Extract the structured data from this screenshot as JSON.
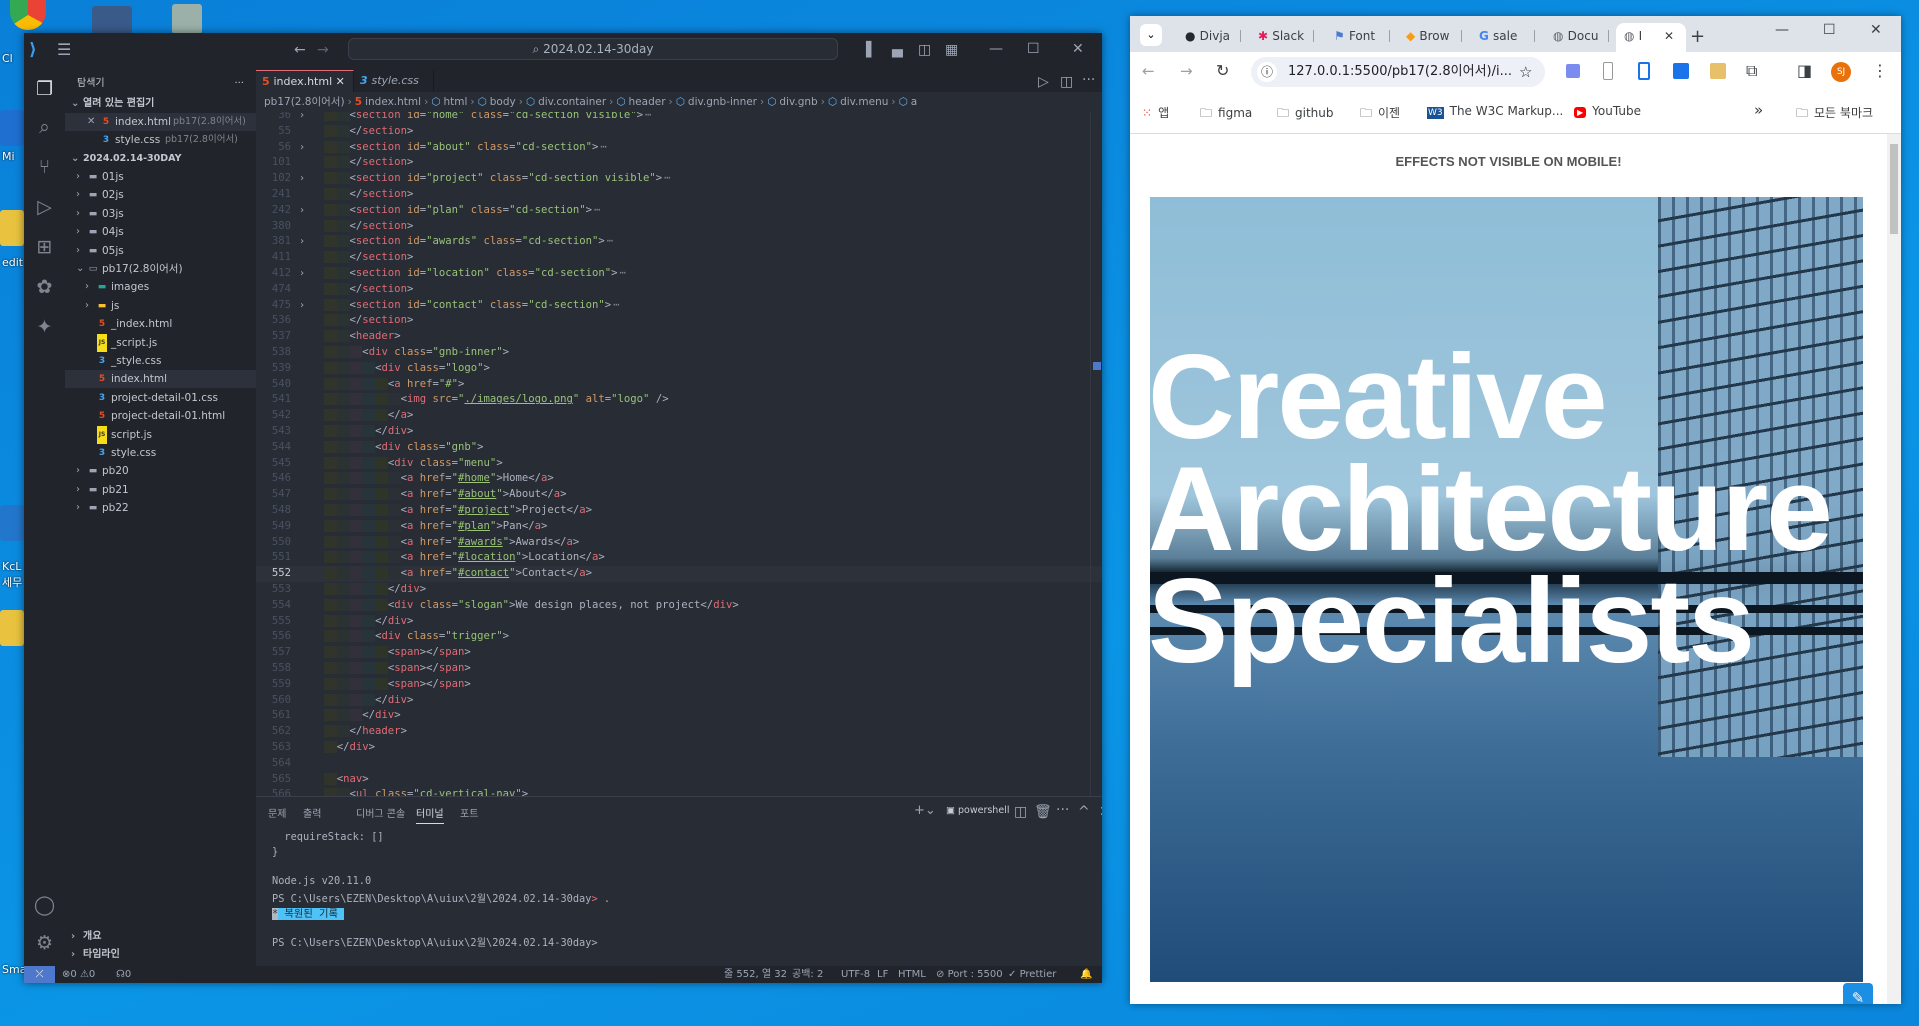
{
  "desktop": {
    "icons": [
      {
        "label": "Cl"
      },
      {
        "label": "Mi"
      },
      {
        "label": "edit"
      },
      {
        "label": "KcL"
      },
      {
        "label": "세무"
      },
      {
        "label": "Sma"
      }
    ]
  },
  "vscode": {
    "search": "2024.02.14-30day",
    "sidebar": {
      "title": "탐색기",
      "more": "···",
      "open_editors_header": "열려 있는 편집기",
      "open_editors": [
        {
          "name": "index.html",
          "folder": "pb17(2.8이어서)",
          "type": "html",
          "close": "✕"
        },
        {
          "name": "style.css",
          "folder": "pb17(2.8이어서)",
          "type": "css"
        }
      ],
      "workspace_header": "2024.02.14-30DAY",
      "tree": [
        {
          "name": "01js",
          "kind": "folder",
          "depth": 0
        },
        {
          "name": "02js",
          "kind": "folder",
          "depth": 0
        },
        {
          "name": "03js",
          "kind": "folder",
          "depth": 0
        },
        {
          "name": "04js",
          "kind": "folder",
          "depth": 0
        },
        {
          "name": "05js",
          "kind": "folder",
          "depth": 0
        },
        {
          "name": "pb17(2.8이어서)",
          "kind": "folder-open",
          "depth": 0
        },
        {
          "name": "images",
          "kind": "folder-img",
          "depth": 1
        },
        {
          "name": "js",
          "kind": "folder-js",
          "depth": 1
        },
        {
          "name": "_index.html",
          "kind": "html",
          "depth": 1
        },
        {
          "name": "_script.js",
          "kind": "js",
          "depth": 1
        },
        {
          "name": "_style.css",
          "kind": "css",
          "depth": 1
        },
        {
          "name": "index.html",
          "kind": "html",
          "depth": 1,
          "selected": true
        },
        {
          "name": "project-detail-01.css",
          "kind": "css",
          "depth": 1
        },
        {
          "name": "project-detail-01.html",
          "kind": "html",
          "depth": 1
        },
        {
          "name": "script.js",
          "kind": "js",
          "depth": 1
        },
        {
          "name": "style.css",
          "kind": "css",
          "depth": 1
        },
        {
          "name": "pb20",
          "kind": "folder",
          "depth": 0
        },
        {
          "name": "pb21",
          "kind": "folder",
          "depth": 0
        },
        {
          "name": "pb22",
          "kind": "folder",
          "depth": 0
        }
      ],
      "outline": "개요",
      "timeline": "타임라인"
    },
    "tabs": [
      {
        "label": "index.html",
        "type": "html",
        "active": true,
        "close": "✕"
      },
      {
        "label": "style.css",
        "type": "css",
        "active": false
      }
    ],
    "breadcrumb": [
      "pb17(2.8이어서)",
      "index.html",
      "html",
      "body",
      "div.container",
      "header",
      "div.gnb-inner",
      "div.gnb",
      "div.menu",
      "a"
    ],
    "cursor_line": 552,
    "code": [
      {
        "n": 36,
        "t": "    <section id=\"home\" class=\"cd-section visible\">",
        "fold": true
      },
      {
        "n": 55,
        "t": "    </section>"
      },
      {
        "n": 56,
        "t": "    <section id=\"about\" class=\"cd-section\">",
        "fold": true
      },
      {
        "n": 101,
        "t": "    </section>"
      },
      {
        "n": 102,
        "t": "    <section id=\"project\" class=\"cd-section visible\">",
        "fold": true
      },
      {
        "n": 241,
        "t": "    </section>"
      },
      {
        "n": 242,
        "t": "    <section id=\"plan\" class=\"cd-section\">",
        "fold": true
      },
      {
        "n": 380,
        "t": "    </section>"
      },
      {
        "n": 381,
        "t": "    <section id=\"awards\" class=\"cd-section\">",
        "fold": true
      },
      {
        "n": 411,
        "t": "    </section>"
      },
      {
        "n": 412,
        "t": "    <section id=\"location\" class=\"cd-section\">",
        "fold": true
      },
      {
        "n": 474,
        "t": "    </section>"
      },
      {
        "n": 475,
        "t": "    <section id=\"contact\" class=\"cd-section\">",
        "fold": true
      },
      {
        "n": 536,
        "t": "    </section>"
      },
      {
        "n": 537,
        "t": "    <header>"
      },
      {
        "n": 538,
        "t": "      <div class=\"gnb-inner\">"
      },
      {
        "n": 539,
        "t": "        <div class=\"logo\">"
      },
      {
        "n": 540,
        "t": "          <a href=\"#\">"
      },
      {
        "n": 541,
        "t": "            <img src=\"./images/logo.png\" alt=\"logo\" />"
      },
      {
        "n": 542,
        "t": "          </a>"
      },
      {
        "n": 543,
        "t": "        </div>"
      },
      {
        "n": 544,
        "t": "        <div class=\"gnb\">"
      },
      {
        "n": 545,
        "t": "          <div class=\"menu\">"
      },
      {
        "n": 546,
        "t": "            <a href=\"#home\">Home</a>"
      },
      {
        "n": 547,
        "t": "            <a href=\"#about\">About</a>"
      },
      {
        "n": 548,
        "t": "            <a href=\"#project\">Project</a>"
      },
      {
        "n": 549,
        "t": "            <a href=\"#plan\">Pan</a>"
      },
      {
        "n": 550,
        "t": "            <a href=\"#awards\">Awards</a>"
      },
      {
        "n": 551,
        "t": "            <a href=\"#location\">Location</a>"
      },
      {
        "n": 552,
        "t": "            <a href=\"#contact\">Contact</a>"
      },
      {
        "n": 553,
        "t": "          </div>"
      },
      {
        "n": 554,
        "t": "          <div class=\"slogan\">We design places, not project</div>"
      },
      {
        "n": 555,
        "t": "        </div>"
      },
      {
        "n": 556,
        "t": "        <div class=\"trigger\">"
      },
      {
        "n": 557,
        "t": "          <span></span>"
      },
      {
        "n": 558,
        "t": "          <span></span>"
      },
      {
        "n": 559,
        "t": "          <span></span>"
      },
      {
        "n": 560,
        "t": "        </div>"
      },
      {
        "n": 561,
        "t": "      </div>"
      },
      {
        "n": 562,
        "t": "    </header>"
      },
      {
        "n": 563,
        "t": "  </div>"
      },
      {
        "n": 564,
        "t": ""
      },
      {
        "n": 565,
        "t": "  <nav>"
      },
      {
        "n": 566,
        "t": "    <ul class=\"cd-vertical-nav\">"
      }
    ],
    "panel": {
      "tabs": [
        "문제",
        "출력",
        "디버그 콘솔",
        "터미널",
        "포트"
      ],
      "active_tab": "터미널",
      "shell": "powershell",
      "terminal": [
        "  requireStack: []",
        "}",
        "",
        "Node.js v20.11.0",
        "PS C:\\Users\\EZEN\\Desktop\\A\\uiux\\2월\\2024.02.14-30day> ."
      ],
      "restored_mark": "*",
      "restored": " 복원된 기록 ",
      "prompt": "PS C:\\Users\\EZEN\\Desktop\\A\\uiux\\2월\\2024.02.14-30day>"
    },
    "status": {
      "errors": "0",
      "warnings": "0",
      "ports": "0",
      "position": "줄 552, 열 32",
      "spaces": "공백: 2",
      "encoding": "UTF-8",
      "eol": "LF",
      "language": "HTML",
      "port": "Port : 5500",
      "prettier": "Prettier"
    },
    "colors": {
      "tag": "#e06c75",
      "attr": "#d19a66",
      "string": "#98c379",
      "text": "#abb2bf",
      "remote": "#4d78cc"
    }
  },
  "chrome": {
    "tabs": [
      {
        "label": "Divja",
        "icon": "github-icon"
      },
      {
        "label": "Slack",
        "icon": "slack-icon"
      },
      {
        "label": "Font",
        "icon": "flag-icon"
      },
      {
        "label": "Brow",
        "icon": "browserstack-icon"
      },
      {
        "label": "sale",
        "icon": "google-icon"
      },
      {
        "label": "Docu",
        "icon": "globe-icon"
      },
      {
        "label": "I",
        "icon": "globe-icon",
        "active": true
      }
    ],
    "new_tab": "+",
    "url": "127.0.0.1:5500/pb17(2.8이어서)/i...",
    "avatar": "SJ",
    "bookmarks": [
      {
        "label": "앱",
        "icon": "apps-icon"
      },
      {
        "label": "figma",
        "icon": "folder-icon"
      },
      {
        "label": "github",
        "icon": "folder-icon"
      },
      {
        "label": "이젠",
        "icon": "folder-icon"
      },
      {
        "label": "The W3C Markup...",
        "icon": "w3c-icon"
      },
      {
        "label": "YouTube",
        "icon": "youtube-icon"
      }
    ],
    "more_bookmarks": "»",
    "all_bookmarks": "모든 북마크",
    "page": {
      "notice": "EFFECTS NOT VISIBLE ON MOBILE!",
      "hero": [
        "Creative",
        "Architecture",
        "Specialists"
      ]
    }
  }
}
